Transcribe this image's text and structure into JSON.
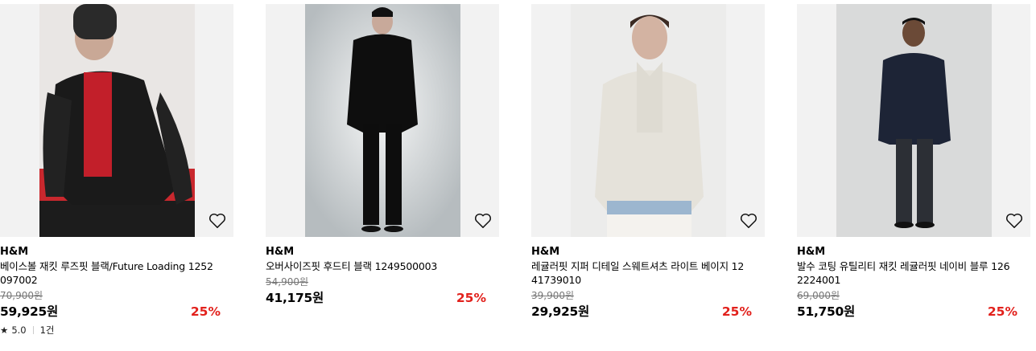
{
  "colors": {
    "discount": "#e2211c",
    "background": "#f2f2f2"
  },
  "products": [
    {
      "brand": "H&M",
      "name": "베이스볼 재킷 루즈핏 블랙/Future Loading 1252097002",
      "original_price": "70,900원",
      "price": "59,925원",
      "discount": "25%",
      "rating": "5.0",
      "review_count": "1건",
      "icon": "heart-outline-icon"
    },
    {
      "brand": "H&M",
      "name": "오버사이즈핏 후드티 블랙 1249500003",
      "original_price": "54,900원",
      "price": "41,175원",
      "discount": "25%",
      "icon": "heart-outline-icon"
    },
    {
      "brand": "H&M",
      "name": "레귤러핏 지퍼 디테일 스웨트셔츠 라이트 베이지 1241739010",
      "original_price": "39,900원",
      "price": "29,925원",
      "discount": "25%",
      "icon": "heart-outline-icon"
    },
    {
      "brand": "H&M",
      "name": "발수 코팅 유틸리티 재킷 레귤러핏 네이비 블루 1262224001",
      "original_price": "69,000원",
      "price": "51,750원",
      "discount": "25%",
      "icon": "heart-outline-icon"
    }
  ]
}
